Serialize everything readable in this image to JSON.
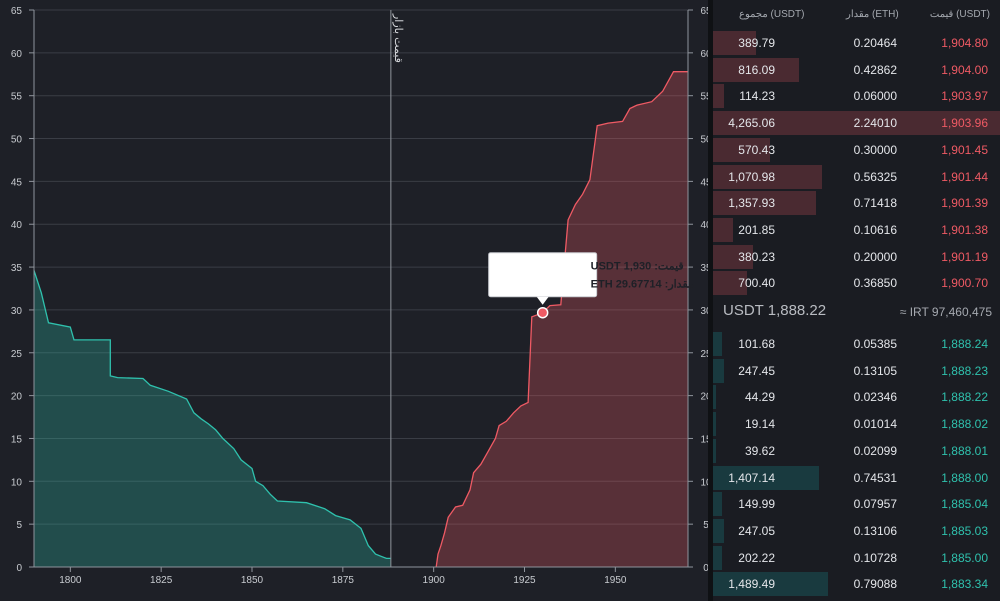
{
  "chart_data": {
    "type": "area",
    "xlim": [
      1790,
      1970
    ],
    "ylim": [
      0,
      65
    ],
    "x_ticks": [
      1800,
      1825,
      1850,
      1875,
      1900,
      1925,
      1950
    ],
    "y_ticks": [
      0,
      5,
      10,
      15,
      20,
      25,
      30,
      35,
      40,
      45,
      50,
      55,
      60,
      65
    ],
    "market_price": 1888.22,
    "market_price_label": "قیمت بازار",
    "series": [
      {
        "side": "bid",
        "color": "#2fc1ad",
        "points": [
          [
            1790,
            34.6
          ],
          [
            1792,
            32
          ],
          [
            1794,
            28.5
          ],
          [
            1800,
            28
          ],
          [
            1801,
            26.5
          ],
          [
            1811,
            26.5
          ],
          [
            1811,
            22.3
          ],
          [
            1813,
            22.1
          ],
          [
            1820,
            22
          ],
          [
            1822,
            21.2
          ],
          [
            1827,
            20.5
          ],
          [
            1832,
            19.6
          ],
          [
            1834,
            18
          ],
          [
            1836,
            17.3
          ],
          [
            1838,
            16.7
          ],
          [
            1840,
            16
          ],
          [
            1842,
            15
          ],
          [
            1845,
            13.8
          ],
          [
            1847,
            12.5
          ],
          [
            1850,
            11.5
          ],
          [
            1851,
            10
          ],
          [
            1853,
            9.5
          ],
          [
            1855,
            8.5
          ],
          [
            1857,
            7.7
          ],
          [
            1865,
            7.5
          ],
          [
            1870,
            6.8
          ],
          [
            1873,
            6
          ],
          [
            1877,
            5.5
          ],
          [
            1880,
            4.5
          ],
          [
            1882,
            2.5
          ],
          [
            1884,
            1.5
          ],
          [
            1887,
            1
          ],
          [
            1888.22,
            1
          ]
        ]
      },
      {
        "side": "ask",
        "color": "#ef5a64",
        "points": [
          [
            1900.7,
            0
          ],
          [
            1901.2,
            1.5
          ],
          [
            1902,
            2.5
          ],
          [
            1903,
            4
          ],
          [
            1904,
            5.8
          ],
          [
            1906,
            7
          ],
          [
            1908,
            7.2
          ],
          [
            1910,
            9
          ],
          [
            1911,
            11
          ],
          [
            1913,
            12
          ],
          [
            1915,
            13.5
          ],
          [
            1917,
            15
          ],
          [
            1918,
            16.5
          ],
          [
            1920,
            17
          ],
          [
            1922,
            18
          ],
          [
            1924,
            18.8
          ],
          [
            1926,
            19.2
          ],
          [
            1927,
            29.2
          ],
          [
            1929,
            29.5
          ],
          [
            1930,
            29.7
          ],
          [
            1932,
            30.5
          ],
          [
            1935,
            30.6
          ],
          [
            1937,
            40.5
          ],
          [
            1939,
            42.3
          ],
          [
            1941,
            43.5
          ],
          [
            1943,
            45.2
          ],
          [
            1945,
            51.5
          ],
          [
            1948,
            51.8
          ],
          [
            1952,
            52
          ],
          [
            1954,
            53.5
          ],
          [
            1956,
            53.9
          ],
          [
            1960,
            54.3
          ],
          [
            1963,
            55.5
          ],
          [
            1966,
            57.8
          ],
          [
            1970,
            57.8
          ]
        ]
      }
    ],
    "tooltip": {
      "price": 1930,
      "amount": 29.67714,
      "price_line": "قیمت: USDT 1,930",
      "amount_line": "مقدار: ETH 29.67714"
    }
  },
  "orderbook": {
    "headers": {
      "price": "قیمت (USDT)",
      "amount": "مقدار (ETH)",
      "total": "مجموع (USDT)"
    },
    "asks": [
      {
        "price": "1,904.80",
        "amount": "0.20464",
        "total": "389.79",
        "depth": 0.15
      },
      {
        "price": "1,904.00",
        "amount": "0.42862",
        "total": "816.09",
        "depth": 0.3
      },
      {
        "price": "1,903.97",
        "amount": "0.06000",
        "total": "114.23",
        "depth": 0.04
      },
      {
        "price": "1,903.96",
        "amount": "2.24010",
        "total": "4,265.06",
        "depth": 1.0
      },
      {
        "price": "1,901.45",
        "amount": "0.30000",
        "total": "570.43",
        "depth": 0.2
      },
      {
        "price": "1,901.44",
        "amount": "0.56325",
        "total": "1,070.98",
        "depth": 0.38
      },
      {
        "price": "1,901.39",
        "amount": "0.71418",
        "total": "1,357.93",
        "depth": 0.36
      },
      {
        "price": "1,901.38",
        "amount": "0.10616",
        "total": "201.85",
        "depth": 0.07
      },
      {
        "price": "1,901.19",
        "amount": "0.20000",
        "total": "380.23",
        "depth": 0.14
      },
      {
        "price": "1,900.70",
        "amount": "0.36850",
        "total": "700.40",
        "depth": 0.12
      }
    ],
    "mid": {
      "usdt": "USDT 1,888.22",
      "irt": "≈ IRT 97,460,475"
    },
    "bids": [
      {
        "price": "1,888.24",
        "amount": "0.05385",
        "total": "101.68",
        "depth": 0.03
      },
      {
        "price": "1,888.23",
        "amount": "0.13105",
        "total": "247.45",
        "depth": 0.04
      },
      {
        "price": "1,888.22",
        "amount": "0.02346",
        "total": "44.29",
        "depth": 0.01
      },
      {
        "price": "1,888.02",
        "amount": "0.01014",
        "total": "19.14",
        "depth": 0.01
      },
      {
        "price": "1,888.01",
        "amount": "0.02099",
        "total": "39.62",
        "depth": 0.01
      },
      {
        "price": "1,888.00",
        "amount": "0.74531",
        "total": "1,407.14",
        "depth": 0.37
      },
      {
        "price": "1,885.04",
        "amount": "0.07957",
        "total": "149.99",
        "depth": 0.03
      },
      {
        "price": "1,885.03",
        "amount": "0.13106",
        "total": "247.05",
        "depth": 0.04
      },
      {
        "price": "1,885.00",
        "amount": "0.10728",
        "total": "202.22",
        "depth": 0.03
      },
      {
        "price": "1,883.34",
        "amount": "0.79088",
        "total": "1,489.49",
        "depth": 0.4
      }
    ]
  }
}
